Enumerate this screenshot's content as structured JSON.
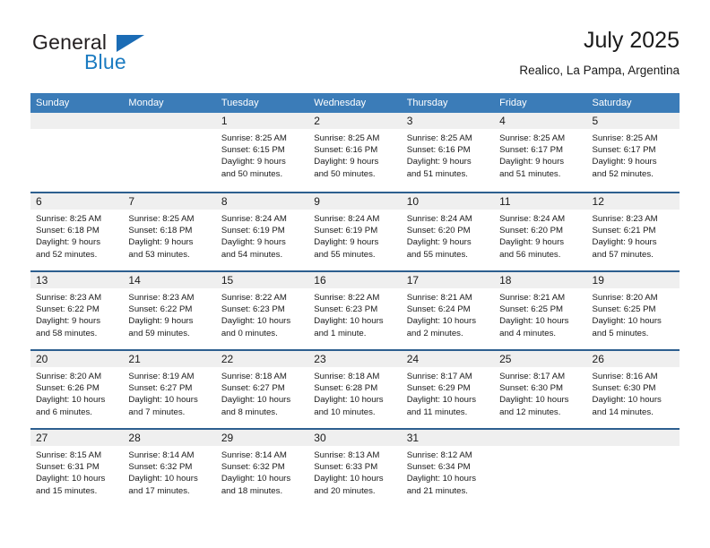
{
  "brand": {
    "name_top": "General",
    "name_bottom": "Blue",
    "triangle_color": "#1b6cb5",
    "text_color_top": "#231f20",
    "text_color_bottom": "#1b7bc1"
  },
  "header": {
    "title": "July 2025",
    "location": "Realico, La Pampa, Argentina"
  },
  "theme": {
    "header_bar_color": "#3b7cb8",
    "row_divider_color": "#2d5f8f",
    "day_band_color": "#efefef",
    "text_color": "#1a1a1a"
  },
  "weekdays": [
    {
      "label": "Sunday"
    },
    {
      "label": "Monday"
    },
    {
      "label": "Tuesday"
    },
    {
      "label": "Wednesday"
    },
    {
      "label": "Thursday"
    },
    {
      "label": "Friday"
    },
    {
      "label": "Saturday"
    }
  ],
  "weeks": [
    [
      {
        "day": "",
        "sunrise": "",
        "sunset": "",
        "daylight_line1": "",
        "daylight_line2": ""
      },
      {
        "day": "",
        "sunrise": "",
        "sunset": "",
        "daylight_line1": "",
        "daylight_line2": ""
      },
      {
        "day": "1",
        "sunrise": "Sunrise: 8:25 AM",
        "sunset": "Sunset: 6:15 PM",
        "daylight_line1": "Daylight: 9 hours",
        "daylight_line2": "and 50 minutes."
      },
      {
        "day": "2",
        "sunrise": "Sunrise: 8:25 AM",
        "sunset": "Sunset: 6:16 PM",
        "daylight_line1": "Daylight: 9 hours",
        "daylight_line2": "and 50 minutes."
      },
      {
        "day": "3",
        "sunrise": "Sunrise: 8:25 AM",
        "sunset": "Sunset: 6:16 PM",
        "daylight_line1": "Daylight: 9 hours",
        "daylight_line2": "and 51 minutes."
      },
      {
        "day": "4",
        "sunrise": "Sunrise: 8:25 AM",
        "sunset": "Sunset: 6:17 PM",
        "daylight_line1": "Daylight: 9 hours",
        "daylight_line2": "and 51 minutes."
      },
      {
        "day": "5",
        "sunrise": "Sunrise: 8:25 AM",
        "sunset": "Sunset: 6:17 PM",
        "daylight_line1": "Daylight: 9 hours",
        "daylight_line2": "and 52 minutes."
      }
    ],
    [
      {
        "day": "6",
        "sunrise": "Sunrise: 8:25 AM",
        "sunset": "Sunset: 6:18 PM",
        "daylight_line1": "Daylight: 9 hours",
        "daylight_line2": "and 52 minutes."
      },
      {
        "day": "7",
        "sunrise": "Sunrise: 8:25 AM",
        "sunset": "Sunset: 6:18 PM",
        "daylight_line1": "Daylight: 9 hours",
        "daylight_line2": "and 53 minutes."
      },
      {
        "day": "8",
        "sunrise": "Sunrise: 8:24 AM",
        "sunset": "Sunset: 6:19 PM",
        "daylight_line1": "Daylight: 9 hours",
        "daylight_line2": "and 54 minutes."
      },
      {
        "day": "9",
        "sunrise": "Sunrise: 8:24 AM",
        "sunset": "Sunset: 6:19 PM",
        "daylight_line1": "Daylight: 9 hours",
        "daylight_line2": "and 55 minutes."
      },
      {
        "day": "10",
        "sunrise": "Sunrise: 8:24 AM",
        "sunset": "Sunset: 6:20 PM",
        "daylight_line1": "Daylight: 9 hours",
        "daylight_line2": "and 55 minutes."
      },
      {
        "day": "11",
        "sunrise": "Sunrise: 8:24 AM",
        "sunset": "Sunset: 6:20 PM",
        "daylight_line1": "Daylight: 9 hours",
        "daylight_line2": "and 56 minutes."
      },
      {
        "day": "12",
        "sunrise": "Sunrise: 8:23 AM",
        "sunset": "Sunset: 6:21 PM",
        "daylight_line1": "Daylight: 9 hours",
        "daylight_line2": "and 57 minutes."
      }
    ],
    [
      {
        "day": "13",
        "sunrise": "Sunrise: 8:23 AM",
        "sunset": "Sunset: 6:22 PM",
        "daylight_line1": "Daylight: 9 hours",
        "daylight_line2": "and 58 minutes."
      },
      {
        "day": "14",
        "sunrise": "Sunrise: 8:23 AM",
        "sunset": "Sunset: 6:22 PM",
        "daylight_line1": "Daylight: 9 hours",
        "daylight_line2": "and 59 minutes."
      },
      {
        "day": "15",
        "sunrise": "Sunrise: 8:22 AM",
        "sunset": "Sunset: 6:23 PM",
        "daylight_line1": "Daylight: 10 hours",
        "daylight_line2": "and 0 minutes."
      },
      {
        "day": "16",
        "sunrise": "Sunrise: 8:22 AM",
        "sunset": "Sunset: 6:23 PM",
        "daylight_line1": "Daylight: 10 hours",
        "daylight_line2": "and 1 minute."
      },
      {
        "day": "17",
        "sunrise": "Sunrise: 8:21 AM",
        "sunset": "Sunset: 6:24 PM",
        "daylight_line1": "Daylight: 10 hours",
        "daylight_line2": "and 2 minutes."
      },
      {
        "day": "18",
        "sunrise": "Sunrise: 8:21 AM",
        "sunset": "Sunset: 6:25 PM",
        "daylight_line1": "Daylight: 10 hours",
        "daylight_line2": "and 4 minutes."
      },
      {
        "day": "19",
        "sunrise": "Sunrise: 8:20 AM",
        "sunset": "Sunset: 6:25 PM",
        "daylight_line1": "Daylight: 10 hours",
        "daylight_line2": "and 5 minutes."
      }
    ],
    [
      {
        "day": "20",
        "sunrise": "Sunrise: 8:20 AM",
        "sunset": "Sunset: 6:26 PM",
        "daylight_line1": "Daylight: 10 hours",
        "daylight_line2": "and 6 minutes."
      },
      {
        "day": "21",
        "sunrise": "Sunrise: 8:19 AM",
        "sunset": "Sunset: 6:27 PM",
        "daylight_line1": "Daylight: 10 hours",
        "daylight_line2": "and 7 minutes."
      },
      {
        "day": "22",
        "sunrise": "Sunrise: 8:18 AM",
        "sunset": "Sunset: 6:27 PM",
        "daylight_line1": "Daylight: 10 hours",
        "daylight_line2": "and 8 minutes."
      },
      {
        "day": "23",
        "sunrise": "Sunrise: 8:18 AM",
        "sunset": "Sunset: 6:28 PM",
        "daylight_line1": "Daylight: 10 hours",
        "daylight_line2": "and 10 minutes."
      },
      {
        "day": "24",
        "sunrise": "Sunrise: 8:17 AM",
        "sunset": "Sunset: 6:29 PM",
        "daylight_line1": "Daylight: 10 hours",
        "daylight_line2": "and 11 minutes."
      },
      {
        "day": "25",
        "sunrise": "Sunrise: 8:17 AM",
        "sunset": "Sunset: 6:30 PM",
        "daylight_line1": "Daylight: 10 hours",
        "daylight_line2": "and 12 minutes."
      },
      {
        "day": "26",
        "sunrise": "Sunrise: 8:16 AM",
        "sunset": "Sunset: 6:30 PM",
        "daylight_line1": "Daylight: 10 hours",
        "daylight_line2": "and 14 minutes."
      }
    ],
    [
      {
        "day": "27",
        "sunrise": "Sunrise: 8:15 AM",
        "sunset": "Sunset: 6:31 PM",
        "daylight_line1": "Daylight: 10 hours",
        "daylight_line2": "and 15 minutes."
      },
      {
        "day": "28",
        "sunrise": "Sunrise: 8:14 AM",
        "sunset": "Sunset: 6:32 PM",
        "daylight_line1": "Daylight: 10 hours",
        "daylight_line2": "and 17 minutes."
      },
      {
        "day": "29",
        "sunrise": "Sunrise: 8:14 AM",
        "sunset": "Sunset: 6:32 PM",
        "daylight_line1": "Daylight: 10 hours",
        "daylight_line2": "and 18 minutes."
      },
      {
        "day": "30",
        "sunrise": "Sunrise: 8:13 AM",
        "sunset": "Sunset: 6:33 PM",
        "daylight_line1": "Daylight: 10 hours",
        "daylight_line2": "and 20 minutes."
      },
      {
        "day": "31",
        "sunrise": "Sunrise: 8:12 AM",
        "sunset": "Sunset: 6:34 PM",
        "daylight_line1": "Daylight: 10 hours",
        "daylight_line2": "and 21 minutes."
      },
      {
        "day": "",
        "sunrise": "",
        "sunset": "",
        "daylight_line1": "",
        "daylight_line2": ""
      },
      {
        "day": "",
        "sunrise": "",
        "sunset": "",
        "daylight_line1": "",
        "daylight_line2": ""
      }
    ]
  ]
}
